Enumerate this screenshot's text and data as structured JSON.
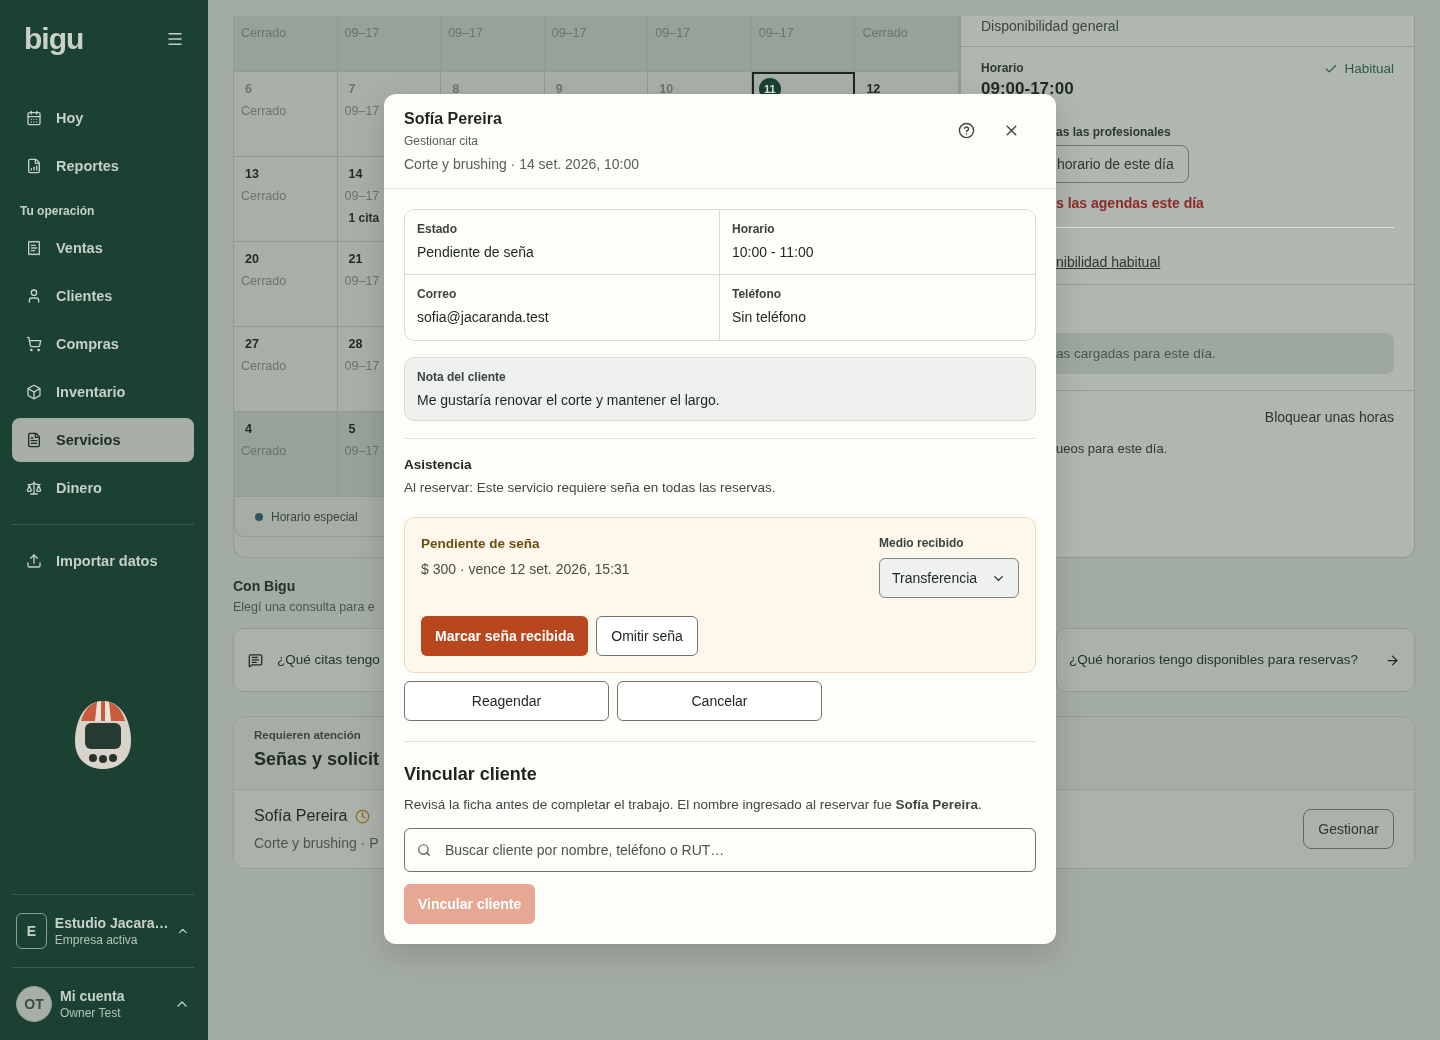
{
  "sidebar": {
    "logo": "bigu",
    "top_items": [
      {
        "label": "Hoy",
        "selected": false
      },
      {
        "label": "Reportes",
        "selected": false
      }
    ],
    "section_title": "Tu operación",
    "items": [
      {
        "label": "Ventas",
        "selected": false
      },
      {
        "label": "Clientes",
        "selected": false
      },
      {
        "label": "Compras",
        "selected": false
      },
      {
        "label": "Inventario",
        "selected": false
      },
      {
        "label": "Servicios",
        "selected": true
      },
      {
        "label": "Dinero",
        "selected": false
      }
    ],
    "import_item": {
      "label": "Importar datos"
    },
    "company": {
      "initial": "E",
      "name": "Estudio Jacara…",
      "status": "Empresa activa"
    },
    "account": {
      "initials": "OT",
      "title": "Mi cuenta",
      "name": "Owner Test"
    }
  },
  "calendar": {
    "weeks": [
      {
        "days": [
          {
            "hours": "Cerrado",
            "outside_month": true
          },
          {
            "hours": "09–17",
            "outside_month": true
          },
          {
            "hours": "09–17",
            "outside_month": true
          },
          {
            "hours": "09–17",
            "outside_month": true
          },
          {
            "hours": "09–17",
            "outside_month": true
          },
          {
            "hours": "09–17",
            "outside_month": true
          },
          {
            "hours": "Cerrado",
            "outside_month": true
          }
        ]
      },
      {
        "days": [
          {
            "date": "6",
            "hours": "Cerrado",
            "past": true,
            "selected": false
          },
          {
            "date": "7",
            "hours": "09–17",
            "past": true,
            "selected": false
          },
          {
            "date": "8",
            "past": true,
            "selected": false
          },
          {
            "date": "9",
            "past": true,
            "selected": false
          },
          {
            "date": "10",
            "past": true,
            "selected": false
          },
          {
            "date": "11",
            "past": false,
            "selected": true
          },
          {
            "date": "12",
            "past": false,
            "selected": false
          }
        ]
      },
      {
        "days": [
          {
            "date": "13",
            "hours": "Cerrado",
            "past": false,
            "selected": false
          },
          {
            "date": "14",
            "hours": "09–17",
            "appointments": "1 cita",
            "past": false,
            "selected": false
          }
        ]
      },
      {
        "days": [
          {
            "date": "20",
            "hours": "Cerrado",
            "past": false,
            "selected": false
          },
          {
            "date": "21",
            "hours": "09–17",
            "past": false,
            "selected": false
          }
        ]
      },
      {
        "days": [
          {
            "date": "27",
            "hours": "Cerrado",
            "past": false,
            "selected": false
          },
          {
            "date": "28",
            "hours": "09–17",
            "past": false,
            "selected": false
          }
        ]
      },
      {
        "days": [
          {
            "date": "4",
            "hours": "Cerrado",
            "outside_month": true,
            "past": false,
            "selected": false
          },
          {
            "date": "5",
            "hours": "09–17",
            "outside_month": true,
            "past": false,
            "selected": false
          }
        ]
      }
    ],
    "legend": [
      {
        "label": "Horario especial",
        "color": "#2d5566"
      }
    ]
  },
  "availability": {
    "title": "Disponibilidad general",
    "schedule_label": "Horario",
    "schedule": "09:00-17:00",
    "status": "Habitual",
    "professionals": "as las profesionales",
    "day_button": "horario de este día",
    "close_link": "s las agendas este día",
    "habitual_link": "nibilidad habitual",
    "notice": "as cargadas para este día.",
    "block_button": "Bloquear unas horas",
    "blocks_empty": "ueos para este día."
  },
  "assistant": {
    "title": "Con Bigu",
    "subtitle": "Elegí una consulta para e",
    "queries": [
      {
        "text": "¿Qué citas tengo"
      },
      {
        "text": "¿Qué horarios tengo disponibles para reservas?"
      }
    ]
  },
  "attention": {
    "eyebrow": "Requieren atención",
    "title": "Señas y solicit",
    "items": [
      {
        "name": "Sofía Pereira",
        "detail": "Corte y brushing · P",
        "action": "Gestionar"
      }
    ]
  },
  "modal": {
    "title": "Sofía Pereira",
    "subtitle": "Gestionar cita",
    "meta": "Corte y brushing · 14 set. 2026, 10:00",
    "details": [
      {
        "label": "Estado",
        "value": "Pendiente de seña"
      },
      {
        "label": "Horario",
        "value": "10:00 - 11:00"
      },
      {
        "label": "Correo",
        "value": "sofia@jacaranda.test"
      },
      {
        "label": "Teléfono",
        "value": "Sin teléfono"
      }
    ],
    "note": {
      "label": "Nota del cliente",
      "text": "Me gustaría renovar el corte y mantener el largo."
    },
    "attendance": {
      "title": "Asistencia",
      "text": "Al reservar: Este servicio requiere seña en todas las reservas."
    },
    "deposit": {
      "title": "Pendiente de seña",
      "detail": "$ 300 · vence 12 set. 2026, 15:31",
      "method_label": "Medio recibido",
      "method": "Transferencia",
      "confirm": "Marcar seña recibida",
      "skip": "Omitir seña"
    },
    "actions": [
      {
        "label": "Reagendar"
      },
      {
        "label": "Cancelar"
      }
    ],
    "link": {
      "title": "Vincular cliente",
      "description": "Revisá la ficha antes de completar el trabajo. El nombre ingresado al reservar fue **Sofía Pereira**.",
      "search_placeholder": "Buscar cliente por nombre, teléfono o RUT…",
      "button": {
        "label": "Vincular cliente",
        "disabled": true
      }
    }
  }
}
